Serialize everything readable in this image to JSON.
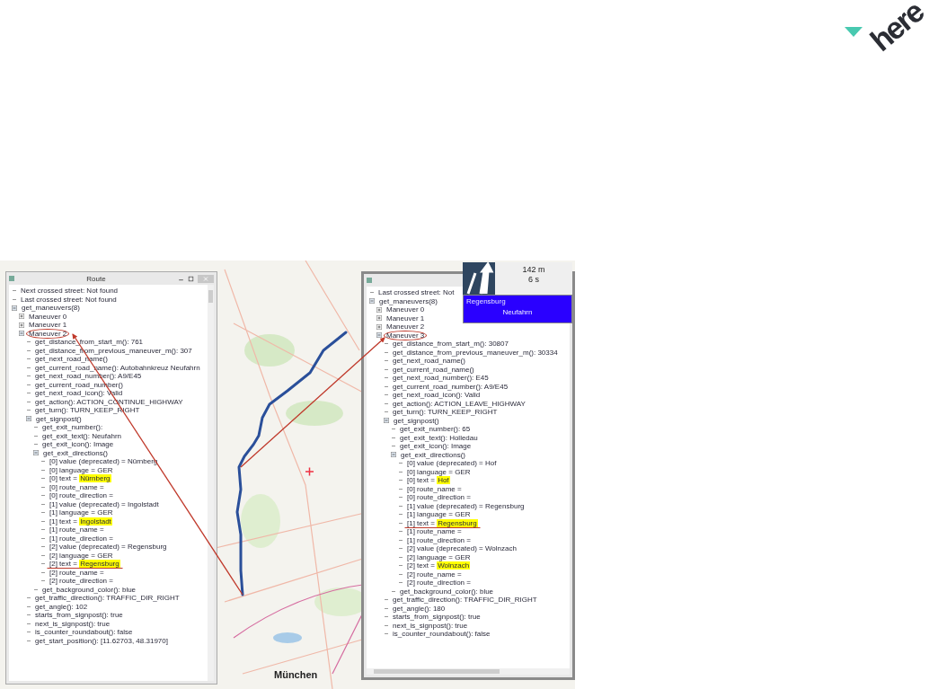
{
  "logo": {
    "text": "here"
  },
  "map": {
    "labels": [
      {
        "text": "München"
      }
    ]
  },
  "left_window": {
    "title": "Route",
    "tree": [
      {
        "text": "Next crossed street: Not found"
      },
      {
        "text": "Last crossed street: Not found"
      },
      {
        "text": "get_maneuvers(8)",
        "expanded": true,
        "children": [
          {
            "text": "Maneuver 0",
            "expanded": false
          },
          {
            "text": "Maneuver 1",
            "expanded": false
          },
          {
            "text": "Maneuver 2",
            "expanded": true,
            "circled": true,
            "children": [
              {
                "text": "get_distance_from_start_m(): 761"
              },
              {
                "text": "get_distance_from_previous_maneuver_m(): 307"
              },
              {
                "text": "get_next_road_name()"
              },
              {
                "text": "get_current_road_name(): Autobahnkreuz Neufahrn"
              },
              {
                "text": "get_next_road_number(): A9/E45"
              },
              {
                "text": "get_current_road_number()"
              },
              {
                "text": "get_next_road_icon(): Valid"
              },
              {
                "text": "get_action(): ACTION_CONTINUE_HIGHWAY"
              },
              {
                "text": "get_turn(): TURN_KEEP_RIGHT"
              },
              {
                "text": "get_signpost()",
                "expanded": true,
                "children": [
                  {
                    "text": "get_exit_number():"
                  },
                  {
                    "text": "get_exit_text(): Neufahrn"
                  },
                  {
                    "text": "get_exit_icon(): Image"
                  },
                  {
                    "text": "get_exit_directions()",
                    "expanded": true,
                    "children": [
                      {
                        "text": "[0] value (deprecated) = Nürnberg"
                      },
                      {
                        "text": "[0] language = GER"
                      },
                      {
                        "text": "[0] text =",
                        "highlight": "Nürnberg"
                      },
                      {
                        "text": "[0] route_name ="
                      },
                      {
                        "text": "[0] route_direction ="
                      },
                      {
                        "text": "[1] value (deprecated) = Ingolstadt"
                      },
                      {
                        "text": "[1] language = GER"
                      },
                      {
                        "text": "[1] text =",
                        "highlight": "Ingolstadt"
                      },
                      {
                        "text": "[1] route_name ="
                      },
                      {
                        "text": "[1] route_direction ="
                      },
                      {
                        "text": "[2] value (deprecated) = Regensburg"
                      },
                      {
                        "text": "[2] language = GER"
                      },
                      {
                        "text": "[2] text =",
                        "highlight": "Regensburg",
                        "underlined": true
                      },
                      {
                        "text": "[2] route_name ="
                      },
                      {
                        "text": "[2] route_direction ="
                      }
                    ]
                  },
                  {
                    "text": "get_background_color(): blue"
                  }
                ]
              },
              {
                "text": "get_traffic_direction(): TRAFFIC_DIR_RIGHT"
              },
              {
                "text": "get_angle(): 102"
              },
              {
                "text": "starts_from_signpost(): true"
              },
              {
                "text": "next_is_signpost(): true"
              },
              {
                "text": "is_counter_roundabout(): false"
              },
              {
                "text": "get_start_position(): [11.62703, 48.31970]"
              }
            ]
          }
        ]
      }
    ]
  },
  "right_window": {
    "tree": [
      {
        "text": "Last crossed street: Not"
      },
      {
        "text": "get_maneuvers(8)",
        "expanded": true,
        "children": [
          {
            "text": "Maneuver 0",
            "expanded": false
          },
          {
            "text": "Maneuver 1",
            "expanded": false
          },
          {
            "text": "Maneuver 2",
            "expanded": false
          },
          {
            "text": "Maneuver 3",
            "expanded": true,
            "circled": true,
            "children": [
              {
                "text": "get_distance_from_start_m(): 30807"
              },
              {
                "text": "get_distance_from_previous_maneuver_m(): 30334"
              },
              {
                "text": "get_next_road_name()"
              },
              {
                "text": "get_current_road_name()"
              },
              {
                "text": "get_next_road_number(): E45"
              },
              {
                "text": "get_current_road_number(): A9/E45"
              },
              {
                "text": "get_next_road_icon(): Valid"
              },
              {
                "text": "get_action(): ACTION_LEAVE_HIGHWAY"
              },
              {
                "text": "get_turn(): TURN_KEEP_RIGHT"
              },
              {
                "text": "get_signpost()",
                "expanded": true,
                "children": [
                  {
                    "text": "get_exit_number(): 65"
                  },
                  {
                    "text": "get_exit_text(): Holledau"
                  },
                  {
                    "text": "get_exit_icon(): Image"
                  },
                  {
                    "text": "get_exit_directions()",
                    "expanded": true,
                    "children": [
                      {
                        "text": "[0] value (deprecated) = Hof"
                      },
                      {
                        "text": "[0] language = GER"
                      },
                      {
                        "text": "[0] text =",
                        "highlight": "Hof"
                      },
                      {
                        "text": "[0] route_name ="
                      },
                      {
                        "text": "[0] route_direction ="
                      },
                      {
                        "text": "[1] value (deprecated) = Regensburg"
                      },
                      {
                        "text": "[1] language = GER"
                      },
                      {
                        "text": "[1] text =",
                        "highlight": "Regensburg",
                        "underlined": true
                      },
                      {
                        "text": "[1] route_name ="
                      },
                      {
                        "text": "[1] route_direction ="
                      },
                      {
                        "text": "[2] value (deprecated) = Wolnzach"
                      },
                      {
                        "text": "[2] language = GER"
                      },
                      {
                        "text": "[2] text =",
                        "highlight": "Wolnzach"
                      },
                      {
                        "text": "[2] route_name ="
                      },
                      {
                        "text": "[2] route_direction ="
                      }
                    ]
                  },
                  {
                    "text": "get_background_color(): blue"
                  }
                ]
              },
              {
                "text": "get_traffic_direction(): TRAFFIC_DIR_RIGHT"
              },
              {
                "text": "get_angle(): 180"
              },
              {
                "text": "starts_from_signpost(): true"
              },
              {
                "text": "next_is_signpost(): true"
              },
              {
                "text": "is_counter_roundabout(): false"
              }
            ]
          }
        ]
      }
    ]
  },
  "guidance_panel": {
    "distance": "142 m",
    "time": "6 s",
    "signpost": {
      "direction": "Regensburg",
      "exit": "Neufahrn"
    }
  }
}
